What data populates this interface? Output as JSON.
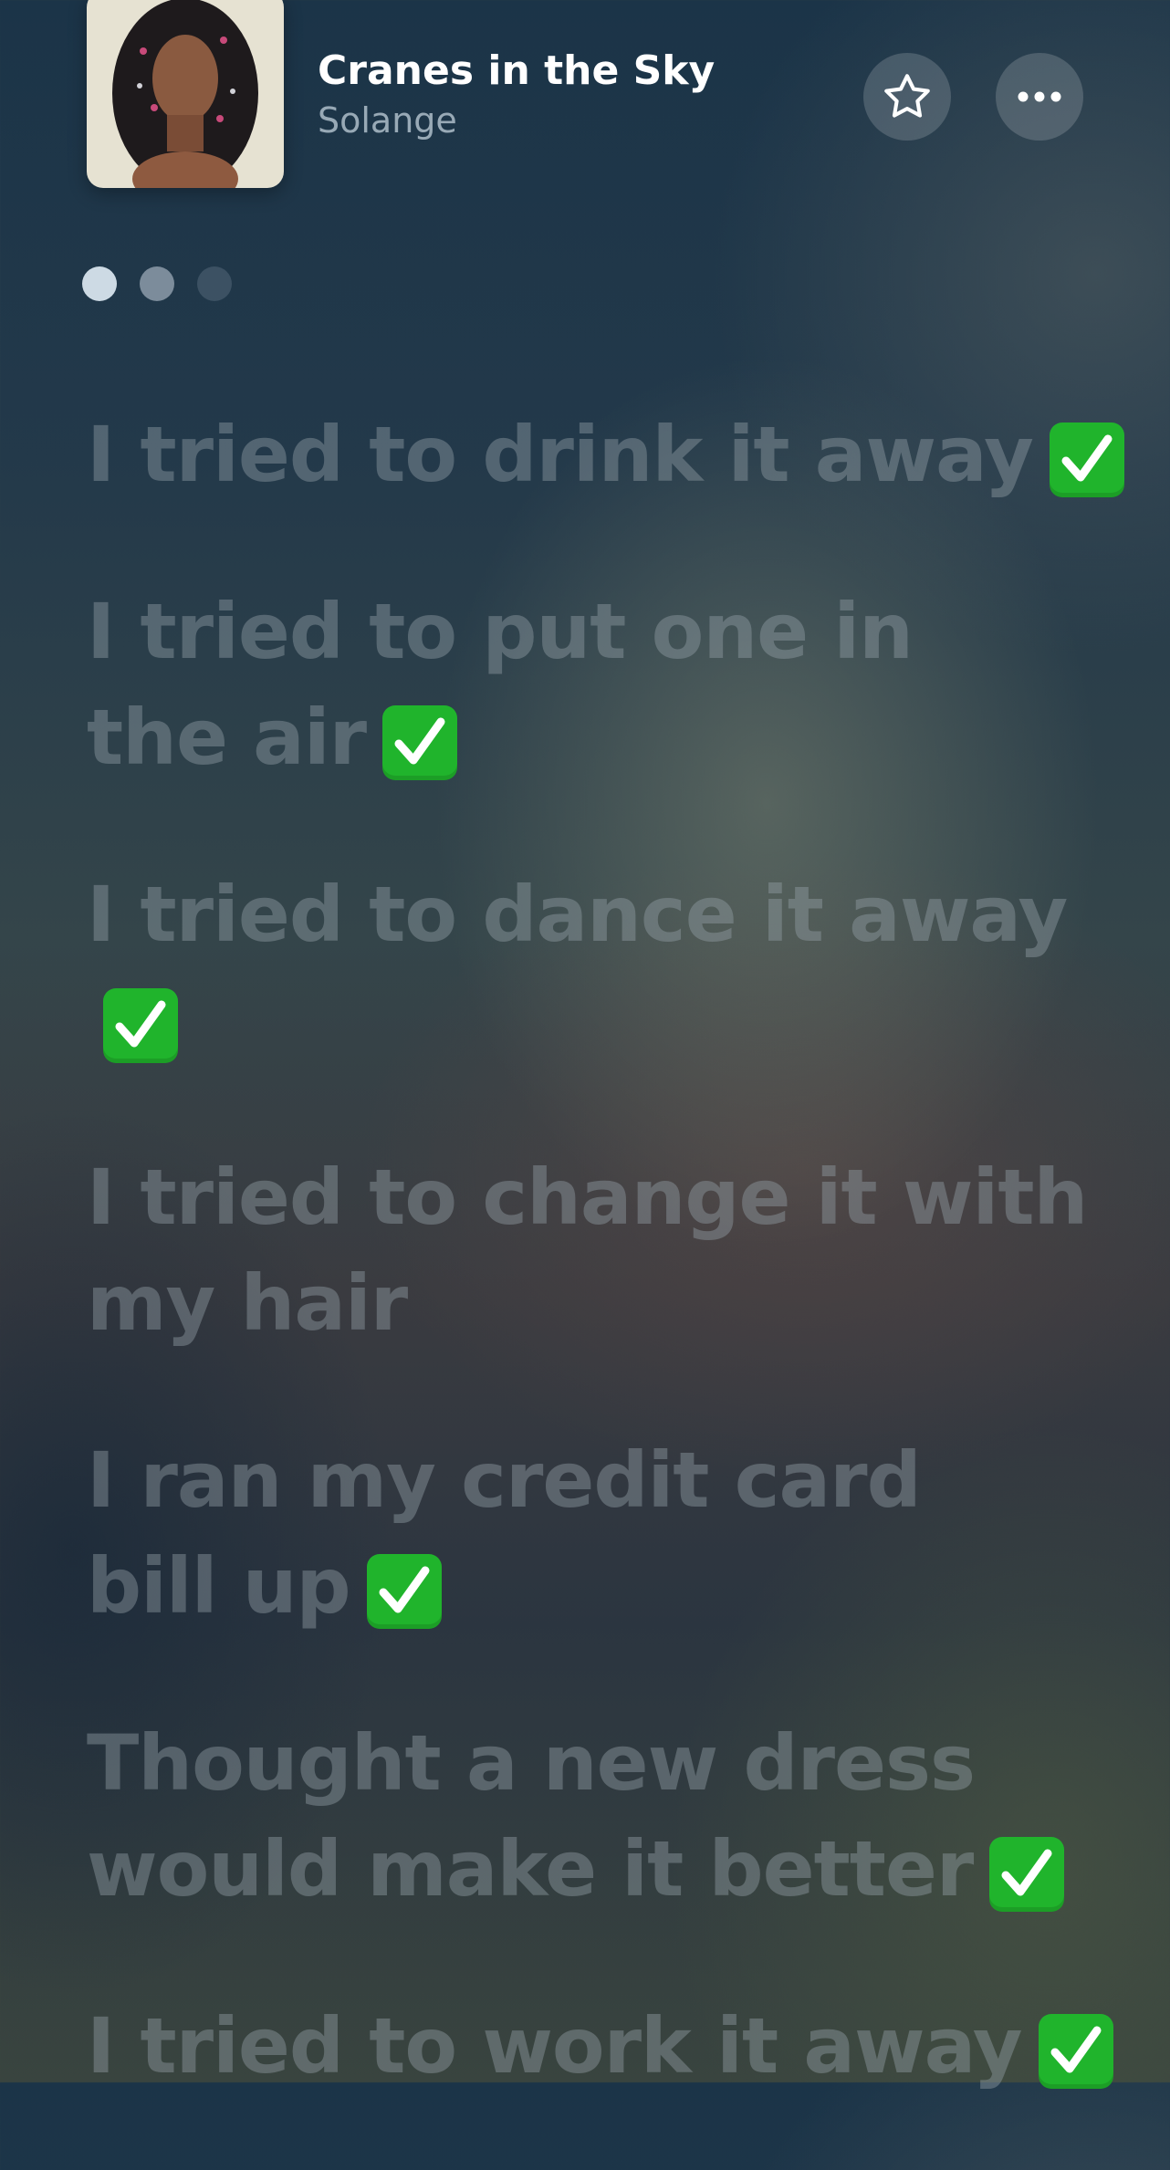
{
  "header": {
    "song_title": "Cranes in the Sky",
    "artist": "Solange",
    "star_icon": "star-outline-icon",
    "more_icon": "ellipsis-icon"
  },
  "page_indicator": {
    "count": 3,
    "active_index": 0
  },
  "lyrics": [
    {
      "text": "I tried to drink it away",
      "checked": true
    },
    {
      "text": "I tried to put one in\nthe air",
      "checked": true
    },
    {
      "text": "I tried to dance it away",
      "checked": true
    },
    {
      "text": "I tried to change it with\nmy hair",
      "checked": false
    },
    {
      "text": "I ran my credit card\nbill up",
      "checked": true
    },
    {
      "text": "Thought a new dress\nwould make it better",
      "checked": true
    },
    {
      "text": "I tried to work it away",
      "checked": true
    }
  ],
  "colors": {
    "check_green": "#20b42c",
    "lyric_dim": "#96a2aa"
  }
}
